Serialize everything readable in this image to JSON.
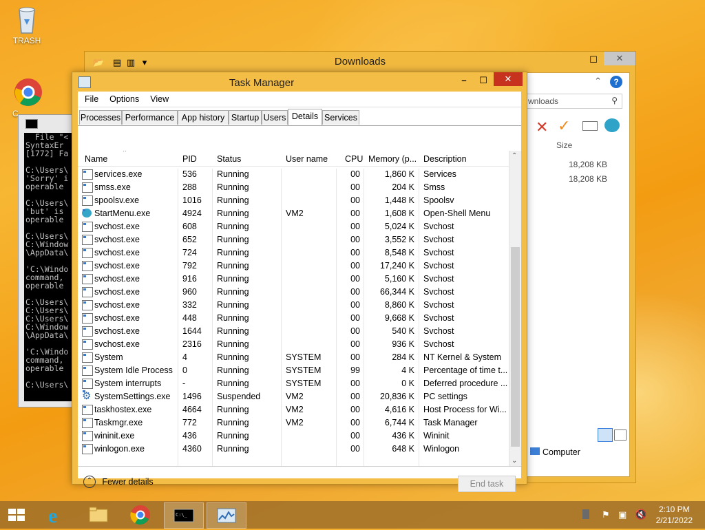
{
  "desktop": {
    "trash_label": "TRASH",
    "chrome_label": "C"
  },
  "explorer": {
    "title": "Downloads",
    "search_placeholder": "wnloads",
    "size_header": "Size",
    "sizes": [
      "18,208 KB",
      "18,208 KB"
    ],
    "nav_computer": "Computer"
  },
  "cmd": {
    "lines": "  File \"<\nSyntaxEr\n[1772] Fa\n\nC:\\Users\\\n'Sorry' i\noperable\n\nC:\\Users\\\n'but' is\noperable\n\nC:\\Users\\\nC:\\Window\n\\AppData\\\n\n'C:\\Windo\ncommand,\noperable\n\nC:\\Users\\\nC:\\Users\\\nC:\\Users\\\nC:\\Window\n\\AppData\\\n\n'C:\\Windo\ncommand,\noperable\n\nC:\\Users\\"
  },
  "taskmgr": {
    "title": "Task Manager",
    "menu": [
      "File",
      "Options",
      "View"
    ],
    "tabs": [
      "Processes",
      "Performance",
      "App history",
      "Startup",
      "Users",
      "Details",
      "Services"
    ],
    "active_tab": "Details",
    "columns": {
      "name": "Name",
      "pid": "PID",
      "status": "Status",
      "user": "User name",
      "cpu": "CPU",
      "memory": "Memory (p...",
      "description": "Description"
    },
    "rows": [
      {
        "name": "services.exe",
        "pid": "536",
        "status": "Running",
        "user": "",
        "cpu": "00",
        "memory": "1,860 K",
        "description": "Services",
        "icon": "process-icon"
      },
      {
        "name": "smss.exe",
        "pid": "288",
        "status": "Running",
        "user": "",
        "cpu": "00",
        "memory": "204 K",
        "description": "Smss",
        "icon": "process-icon"
      },
      {
        "name": "spoolsv.exe",
        "pid": "1016",
        "status": "Running",
        "user": "",
        "cpu": "00",
        "memory": "1,448 K",
        "description": "Spoolsv",
        "icon": "process-icon"
      },
      {
        "name": "StartMenu.exe",
        "pid": "4924",
        "status": "Running",
        "user": "VM2",
        "cpu": "00",
        "memory": "1,608 K",
        "description": "Open-Shell Menu",
        "icon": "shell-icon"
      },
      {
        "name": "svchost.exe",
        "pid": "608",
        "status": "Running",
        "user": "",
        "cpu": "00",
        "memory": "5,024 K",
        "description": "Svchost",
        "icon": "process-icon"
      },
      {
        "name": "svchost.exe",
        "pid": "652",
        "status": "Running",
        "user": "",
        "cpu": "00",
        "memory": "3,552 K",
        "description": "Svchost",
        "icon": "process-icon"
      },
      {
        "name": "svchost.exe",
        "pid": "724",
        "status": "Running",
        "user": "",
        "cpu": "00",
        "memory": "8,548 K",
        "description": "Svchost",
        "icon": "process-icon"
      },
      {
        "name": "svchost.exe",
        "pid": "792",
        "status": "Running",
        "user": "",
        "cpu": "00",
        "memory": "17,240 K",
        "description": "Svchost",
        "icon": "process-icon"
      },
      {
        "name": "svchost.exe",
        "pid": "916",
        "status": "Running",
        "user": "",
        "cpu": "00",
        "memory": "5,160 K",
        "description": "Svchost",
        "icon": "process-icon"
      },
      {
        "name": "svchost.exe",
        "pid": "960",
        "status": "Running",
        "user": "",
        "cpu": "00",
        "memory": "66,344 K",
        "description": "Svchost",
        "icon": "process-icon"
      },
      {
        "name": "svchost.exe",
        "pid": "332",
        "status": "Running",
        "user": "",
        "cpu": "00",
        "memory": "8,860 K",
        "description": "Svchost",
        "icon": "process-icon"
      },
      {
        "name": "svchost.exe",
        "pid": "448",
        "status": "Running",
        "user": "",
        "cpu": "00",
        "memory": "9,668 K",
        "description": "Svchost",
        "icon": "process-icon"
      },
      {
        "name": "svchost.exe",
        "pid": "1644",
        "status": "Running",
        "user": "",
        "cpu": "00",
        "memory": "540 K",
        "description": "Svchost",
        "icon": "process-icon"
      },
      {
        "name": "svchost.exe",
        "pid": "2316",
        "status": "Running",
        "user": "",
        "cpu": "00",
        "memory": "936 K",
        "description": "Svchost",
        "icon": "process-icon"
      },
      {
        "name": "System",
        "pid": "4",
        "status": "Running",
        "user": "SYSTEM",
        "cpu": "00",
        "memory": "284 K",
        "description": "NT Kernel & System",
        "icon": "process-icon"
      },
      {
        "name": "System Idle Process",
        "pid": "0",
        "status": "Running",
        "user": "SYSTEM",
        "cpu": "99",
        "memory": "4 K",
        "description": "Percentage of time t...",
        "icon": "process-icon"
      },
      {
        "name": "System interrupts",
        "pid": "-",
        "status": "Running",
        "user": "SYSTEM",
        "cpu": "00",
        "memory": "0 K",
        "description": "Deferred procedure ...",
        "icon": "process-icon"
      },
      {
        "name": "SystemSettings.exe",
        "pid": "1496",
        "status": "Suspended",
        "user": "VM2",
        "cpu": "00",
        "memory": "20,836 K",
        "description": "PC settings",
        "icon": "gear-icon"
      },
      {
        "name": "taskhostex.exe",
        "pid": "4664",
        "status": "Running",
        "user": "VM2",
        "cpu": "00",
        "memory": "4,616 K",
        "description": "Host Process for Wi...",
        "icon": "process-icon"
      },
      {
        "name": "Taskmgr.exe",
        "pid": "772",
        "status": "Running",
        "user": "VM2",
        "cpu": "00",
        "memory": "6,744 K",
        "description": "Task Manager",
        "icon": "taskmgr-icon"
      },
      {
        "name": "wininit.exe",
        "pid": "436",
        "status": "Running",
        "user": "",
        "cpu": "00",
        "memory": "436 K",
        "description": "Wininit",
        "icon": "process-icon"
      },
      {
        "name": "winlogon.exe",
        "pid": "4360",
        "status": "Running",
        "user": "",
        "cpu": "00",
        "memory": "648 K",
        "description": "Winlogon",
        "icon": "process-icon"
      }
    ],
    "fewer_details": "Fewer details",
    "end_task": "End task"
  },
  "taskbar": {
    "time": "2:10 PM",
    "date": "2/21/2022"
  },
  "colors": {
    "window_frame": "#f4bd46",
    "desktop": "#f5a623",
    "close_button": "#c7321f"
  }
}
